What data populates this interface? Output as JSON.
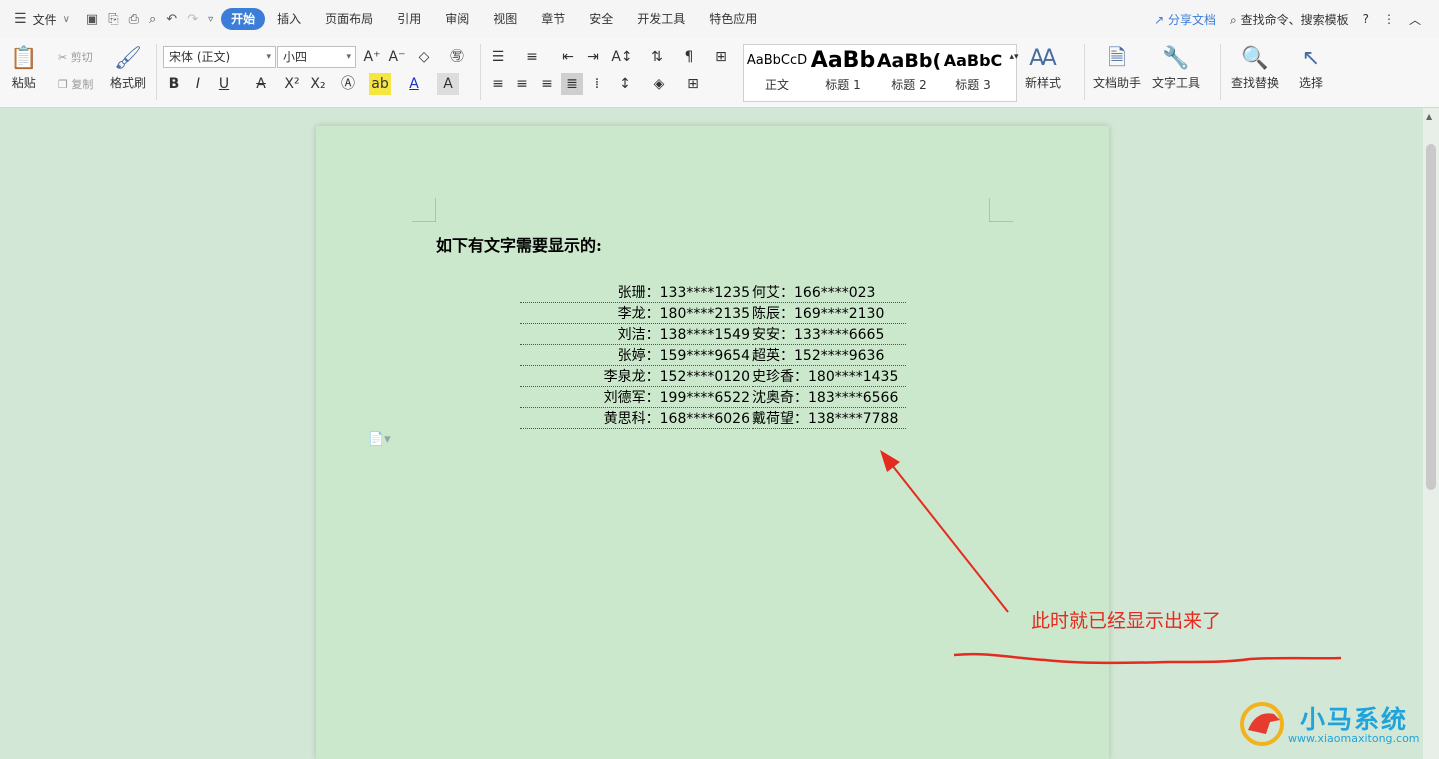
{
  "menu": {
    "file_label": "文件",
    "tabs": [
      "开始",
      "插入",
      "页面布局",
      "引用",
      "审阅",
      "视图",
      "章节",
      "安全",
      "开发工具",
      "特色应用"
    ],
    "share_label": "分享文档",
    "search_label": "查找命令、搜索模板",
    "help": "?",
    "more": "⋮",
    "collapse": "︿"
  },
  "ribbon": {
    "paste": "粘贴",
    "cut": "剪切",
    "copy": "复制",
    "format_painter": "格式刷",
    "font_name": "宋体 (正文)",
    "font_size": "小四",
    "styles": [
      {
        "sample": "AaBbCcD",
        "label": "正文"
      },
      {
        "sample": "AaBb",
        "label": "标题 1"
      },
      {
        "sample": "AaBb(",
        "label": "标题 2"
      },
      {
        "sample": "AaBbC",
        "label": "标题 3"
      }
    ],
    "new_style": "新样式",
    "doc_assistant": "文档助手",
    "text_tools": "文字工具",
    "find_replace": "查找替换",
    "select": "选择"
  },
  "document": {
    "title": "如下有文字需要显示的:",
    "left_entries": [
      {
        "name": "张珊",
        "phone": "133****1235"
      },
      {
        "name": "李龙",
        "phone": "180****2135"
      },
      {
        "name": "刘洁",
        "phone": "138****1549"
      },
      {
        "name": "张婷",
        "phone": "159****9654"
      },
      {
        "name": "李泉龙",
        "phone": "152****0120"
      },
      {
        "name": "刘德军",
        "phone": "199****6522"
      },
      {
        "name": "黄思科",
        "phone": "168****6026"
      }
    ],
    "right_entries": [
      {
        "name": "何艾",
        "phone": "166****023"
      },
      {
        "name": "陈辰",
        "phone": "169****2130"
      },
      {
        "name": "安安",
        "phone": "133****6665"
      },
      {
        "name": "超英",
        "phone": "152****9636"
      },
      {
        "name": "史珍香",
        "phone": "180****1435"
      },
      {
        "name": "沈奥奇",
        "phone": "183****6566"
      },
      {
        "name": "戴荷望",
        "phone": "138****7788"
      }
    ]
  },
  "annotation": {
    "text": "此时就已经显示出来了",
    "color": "#e52a20"
  },
  "watermark": {
    "brand": "小马系统",
    "url": "www.xiaomaxitong.com"
  }
}
